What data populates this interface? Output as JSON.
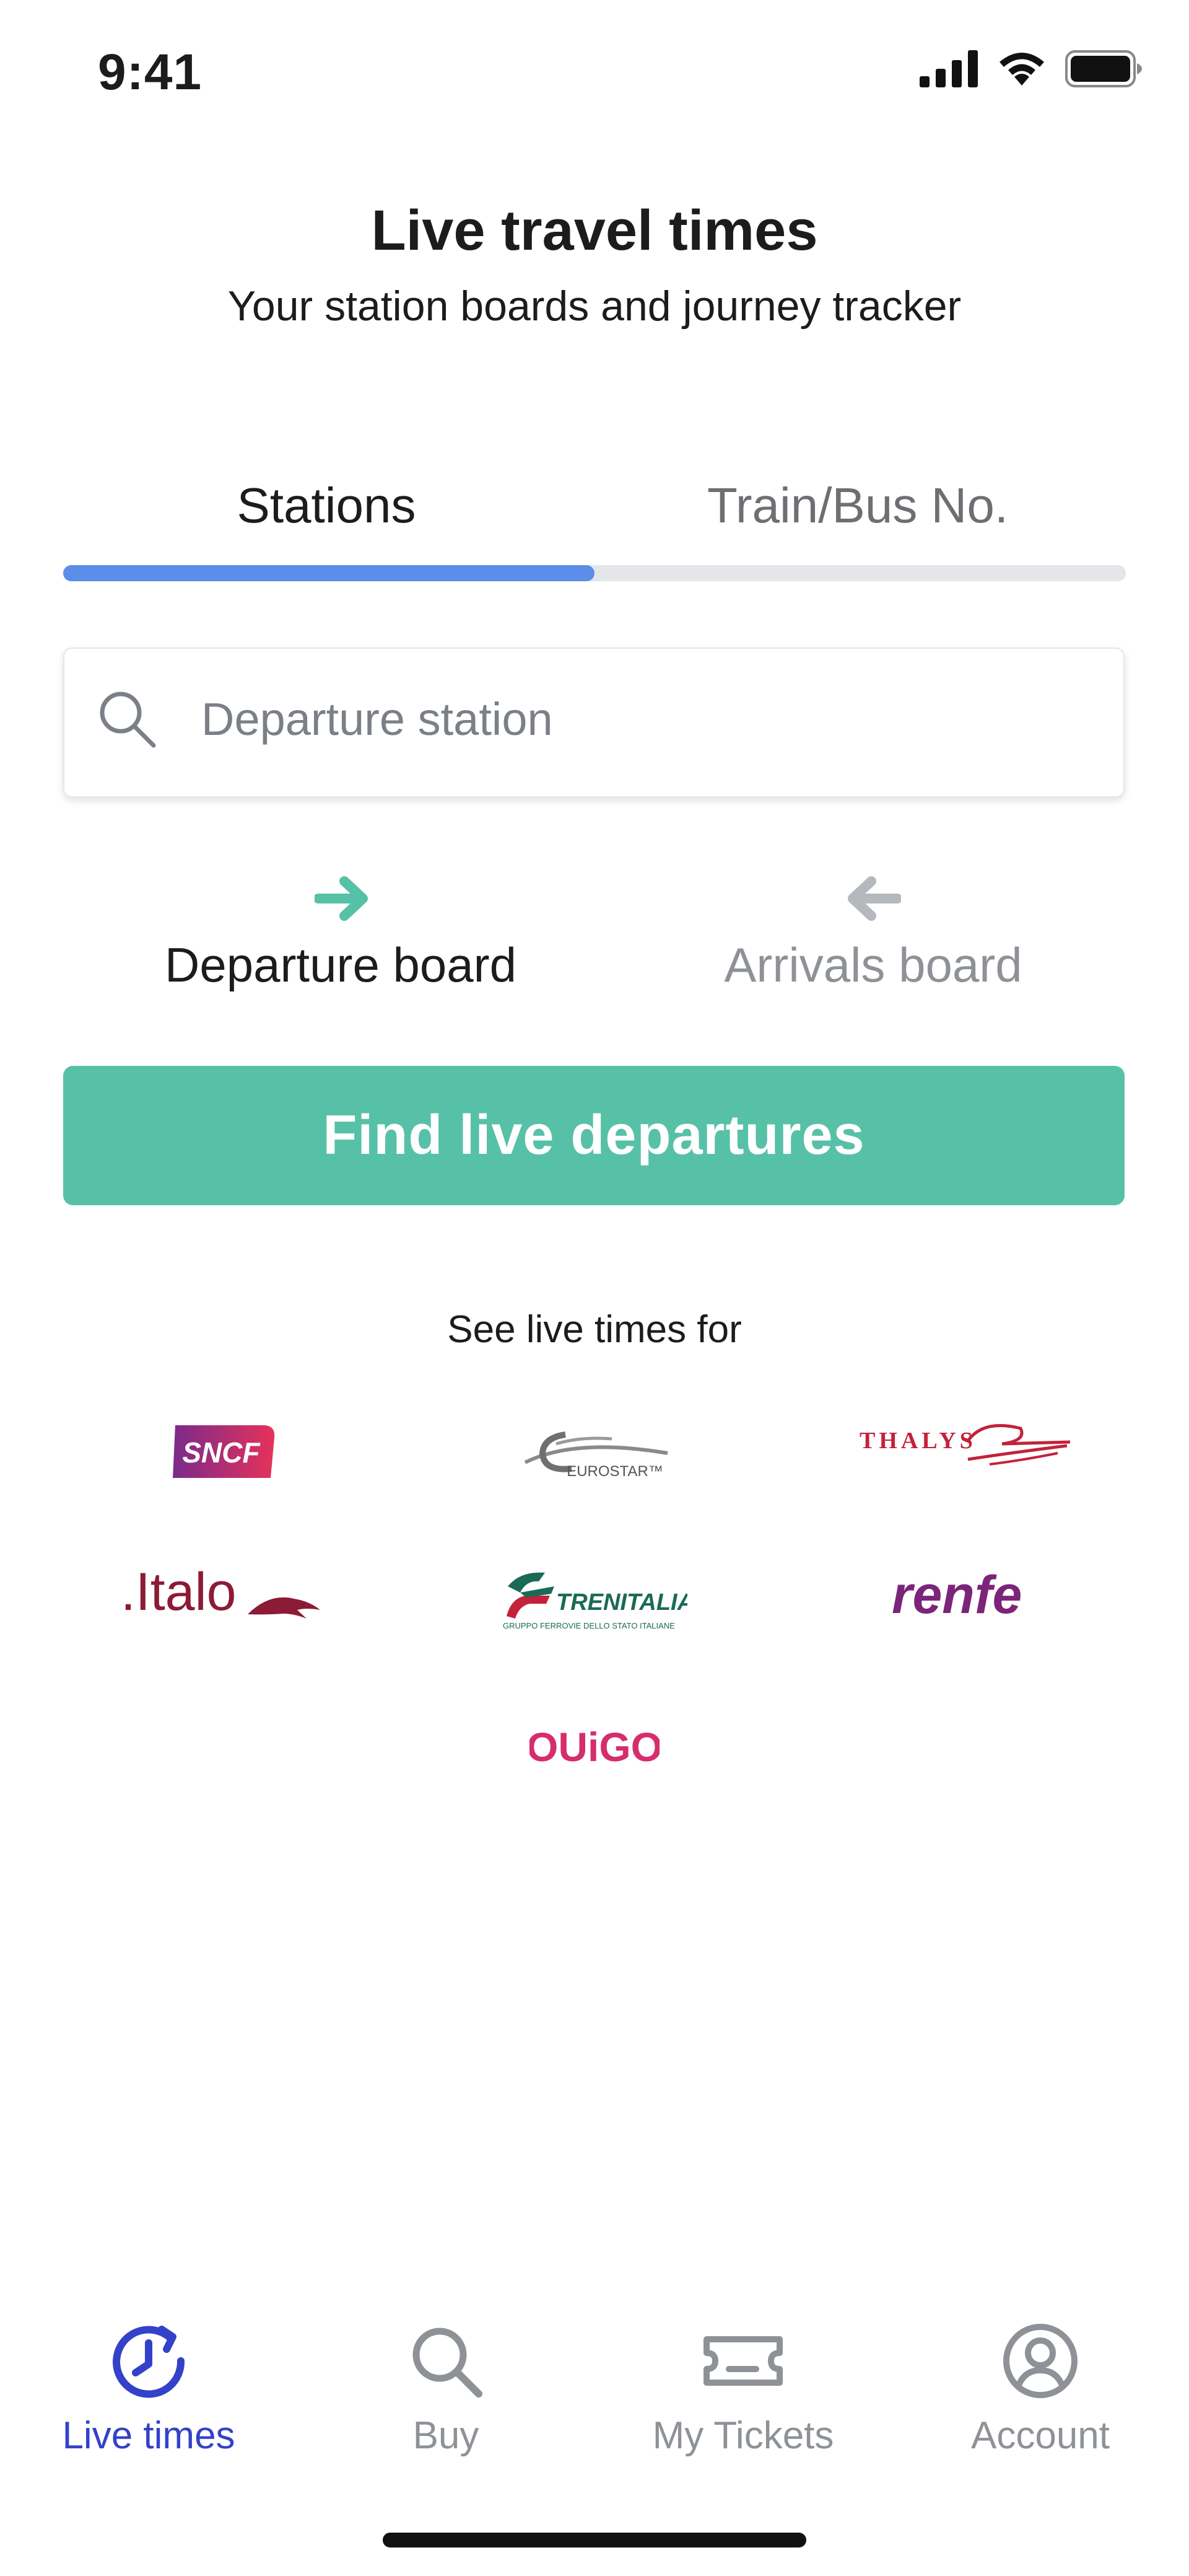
{
  "status_bar": {
    "time": "9:41"
  },
  "header": {
    "title": "Live travel times",
    "subtitle": "Your station boards and journey tracker"
  },
  "tabs": [
    {
      "label": "Stations",
      "active": true
    },
    {
      "label": "Train/Bus No.",
      "active": false
    }
  ],
  "search": {
    "placeholder": "Departure station",
    "value": ""
  },
  "boards": {
    "departure": {
      "label": "Departure board",
      "selected": true
    },
    "arrivals": {
      "label": "Arrivals board",
      "selected": false
    }
  },
  "cta": {
    "label": "Find live departures"
  },
  "operators": {
    "heading": "See live times for",
    "items": [
      {
        "name": "SNCF",
        "text": "SNCF",
        "color": "#b2217b"
      },
      {
        "name": "Eurostar",
        "text": "EUROSTAR™",
        "color": "#7a7a7a"
      },
      {
        "name": "Thalys",
        "text": "THALYS",
        "color": "#c3223a"
      },
      {
        "name": "Italo",
        "text": ".Italo",
        "color": "#8c1b35"
      },
      {
        "name": "Trenitalia",
        "text": "TRENITALIA",
        "subtext": "GRUPPO FERROVIE DELLO STATO ITALIANE",
        "color": "#1a6a55"
      },
      {
        "name": "Renfe",
        "text": "renfe",
        "color": "#7b2479"
      },
      {
        "name": "Ouigo",
        "text": "OUiGO",
        "color": "#d62d6c"
      }
    ]
  },
  "bottom_nav": [
    {
      "label": "Live times",
      "icon": "clock-icon",
      "active": true
    },
    {
      "label": "Buy",
      "icon": "search-icon",
      "active": false
    },
    {
      "label": "My Tickets",
      "icon": "ticket-icon",
      "active": false
    },
    {
      "label": "Account",
      "icon": "account-icon",
      "active": false
    }
  ],
  "colors": {
    "accent_green": "#57c1a7",
    "tab_blue": "#5b8ee8",
    "nav_active": "#3441c9",
    "inactive_gray": "#8e9297"
  }
}
